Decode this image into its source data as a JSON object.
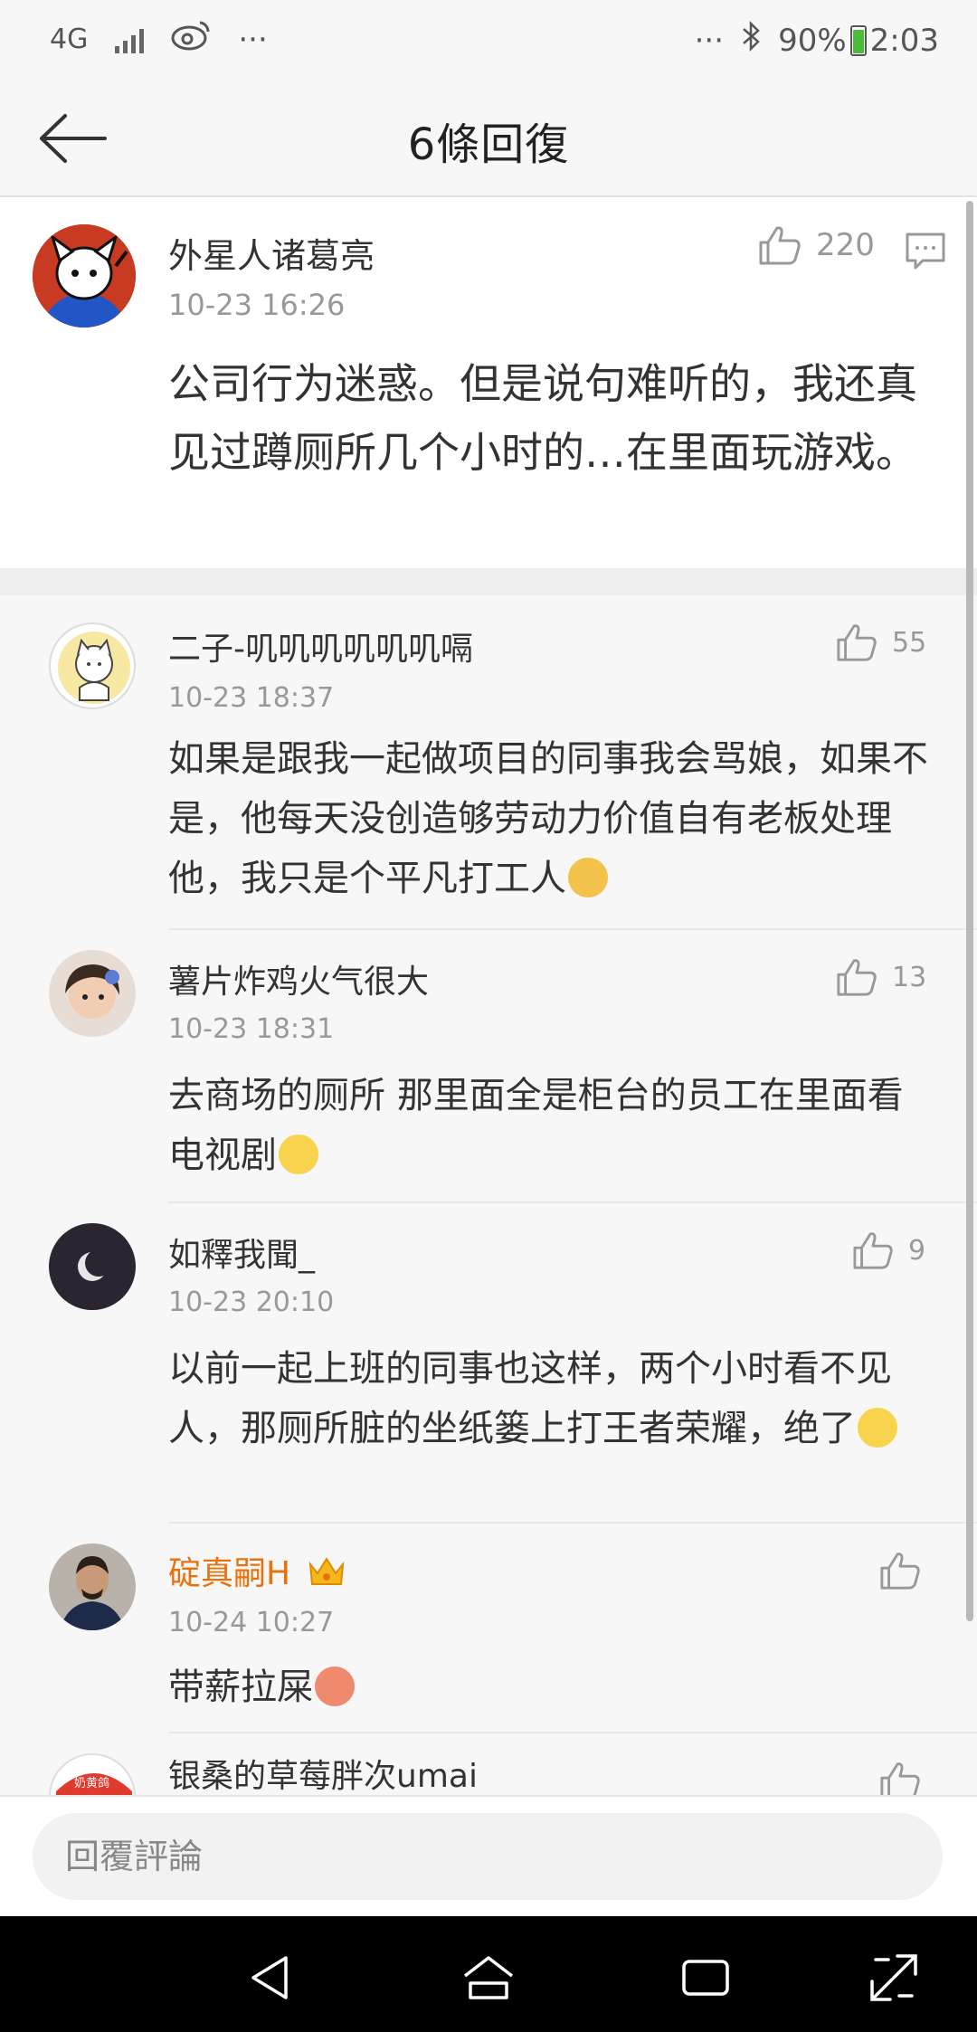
{
  "status_bar": {
    "network": "4G",
    "more": "···",
    "more_right": "···",
    "battery": "90%",
    "time": "2:03"
  },
  "header": {
    "title": "6條回復"
  },
  "main_comment": {
    "username": "外星人诸葛亮",
    "time": "10-23 16:26",
    "likes": "220",
    "text": "公司行为迷惑。但是说句难听的，我还真见过蹲厕所几个小时的…在里面玩游戏。"
  },
  "replies": [
    {
      "username": "二子-叽叽叽叽叽叽嗝",
      "time": "10-23 18:37",
      "likes": "55",
      "text": "如果是跟我一起做项目的同事我会骂娘，如果不是，他每天没创造够劳动力价值自有老板处理他，我只是个平凡打工人"
    },
    {
      "username": "薯片炸鸡火气很大",
      "time": "10-23 18:31",
      "likes": "13",
      "text": "去商场的厕所 那里面全是柜台的员工在里面看电视剧"
    },
    {
      "username": "如釋我聞_",
      "time": "10-23 20:10",
      "likes": "9",
      "text": "以前一起上班的同事也这样，两个小时看不见人，那厕所脏的坐纸篓上打王者荣耀，绝了"
    },
    {
      "username": "碇真嗣H",
      "time": "10-24 10:27",
      "likes": "",
      "text": "带薪拉屎"
    },
    {
      "username": "银桑的草莓胖次umai",
      "time": "",
      "likes": "",
      "text": "",
      "avatar_badge": "奶黄鸽"
    }
  ],
  "reply_bar": {
    "placeholder": "回覆評論"
  },
  "colors": {
    "vip_username": "#e8720c",
    "muted": "#999999",
    "background": "#f7f7f7"
  },
  "icons": [
    "back-arrow-icon",
    "thumbs-up-icon",
    "comment-icon",
    "bluetooth-icon",
    "battery-icon",
    "weibo-icon",
    "crown-icon"
  ]
}
